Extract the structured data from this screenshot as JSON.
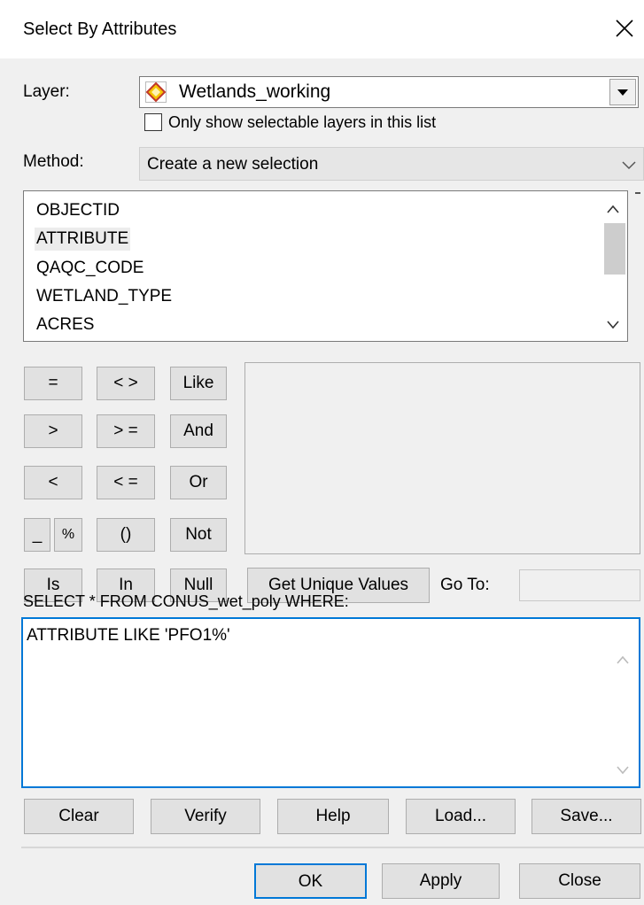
{
  "window": {
    "title": "Select By Attributes"
  },
  "layer": {
    "label": "Layer:",
    "value": "Wetlands_working",
    "checkbox_label": "Only show selectable layers in this list",
    "checkbox_checked": false
  },
  "method": {
    "label": "Method:",
    "value": "Create a new selection"
  },
  "fields": [
    "OBJECTID",
    "ATTRIBUTE",
    "QAQC_CODE",
    "WETLAND_TYPE",
    "ACRES"
  ],
  "selected_field": "ATTRIBUTE",
  "operators": {
    "eq": "=",
    "ne": "< >",
    "like": "Like",
    "gt": ">",
    "ge": "> =",
    "and": "And",
    "lt": "<",
    "le": "< =",
    "or": "Or",
    "underscore": "_",
    "percent": "%",
    "parens": "()",
    "not": "Not",
    "is": "Is",
    "in": "In",
    "null": "Null"
  },
  "unique": {
    "button": "Get Unique Values",
    "goto_label": "Go To:",
    "goto_value": ""
  },
  "query": {
    "label": "SELECT * FROM CONUS_wet_poly WHERE:",
    "text": "ATTRIBUTE LIKE 'PFO1%'"
  },
  "actions": {
    "clear": "Clear",
    "verify": "Verify",
    "help": "Help",
    "load": "Load...",
    "save": "Save..."
  },
  "footer": {
    "ok": "OK",
    "apply": "Apply",
    "close": "Close"
  },
  "colors": {
    "focus_border": "#0078d7",
    "layer_icon_fill": "#f5c400",
    "layer_icon_stroke": "#c0392b"
  }
}
